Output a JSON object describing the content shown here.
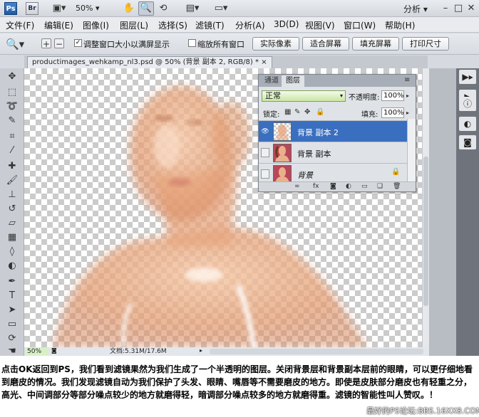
{
  "app": {
    "logo": "Ps",
    "bridge_logo": "Br",
    "zoom": "50%",
    "workspace": "分析",
    "toolbar_icons": [
      "layout-icon",
      "hand-icon",
      "zoom-icon",
      "rotate-icon",
      "arrange-icon",
      "screen-mode-icon"
    ]
  },
  "menu": [
    "文件(F)",
    "编辑(E)",
    "图像(I)",
    "图层(L)",
    "选择(S)",
    "滤镜(T)",
    "分析(A)",
    "3D(D)",
    "视图(V)",
    "窗口(W)",
    "帮助(H)"
  ],
  "options": {
    "resize_windows_label": "调整窗口大小以满屏显示",
    "resize_windows_checked": true,
    "zoom_all_label": "缩放所有窗口",
    "zoom_all_checked": false,
    "buttons": [
      "实际像素",
      "适合屏幕",
      "填充屏幕",
      "打印尺寸"
    ]
  },
  "document": {
    "tab_title": "productimages_wehkamp_nl3.psd @ 50% (背景 副本 2, RGB/8) *"
  },
  "status": {
    "zoom": "50%",
    "doc_size": "文档:5.31M/17.6M"
  },
  "layers_panel": {
    "tabs": [
      "通道",
      "图层"
    ],
    "active_tab": "图层",
    "blend_mode": "正常",
    "opacity_label": "不透明度:",
    "opacity": "100%",
    "lock_label": "锁定:",
    "fill_label": "填充:",
    "fill": "100%",
    "layers": [
      {
        "name": "背景 副本 2",
        "selected": true,
        "visible": true
      },
      {
        "name": "背景 副本",
        "selected": false,
        "visible": false
      },
      {
        "name": "背景",
        "selected": false,
        "visible": false
      }
    ]
  },
  "caption": "点击OK返回到PS，我们看到滤镜果然为我们生成了一个半透明的图层。关闭背景层和背景副本层前的眼睛，可以更仔细地看到磨皮的情况。我们发现滤镜自动为我们保护了头发、眼睛、嘴唇等不需要磨皮的地方。即使是皮肤部分磨皮也有轻重之分，高光、中间调部分等部分噪点较少的地方就磨得轻，暗调部分噪点较多的地方就磨得重。滤镜的智能性叫人赞叹。！",
  "watermark": "最好的PS论坛:BBS.16XX8.COM",
  "colors": {
    "selected_layer": "#3a6fc0",
    "blend_field": "#c9e6a6",
    "skin": "#e8a57e"
  }
}
